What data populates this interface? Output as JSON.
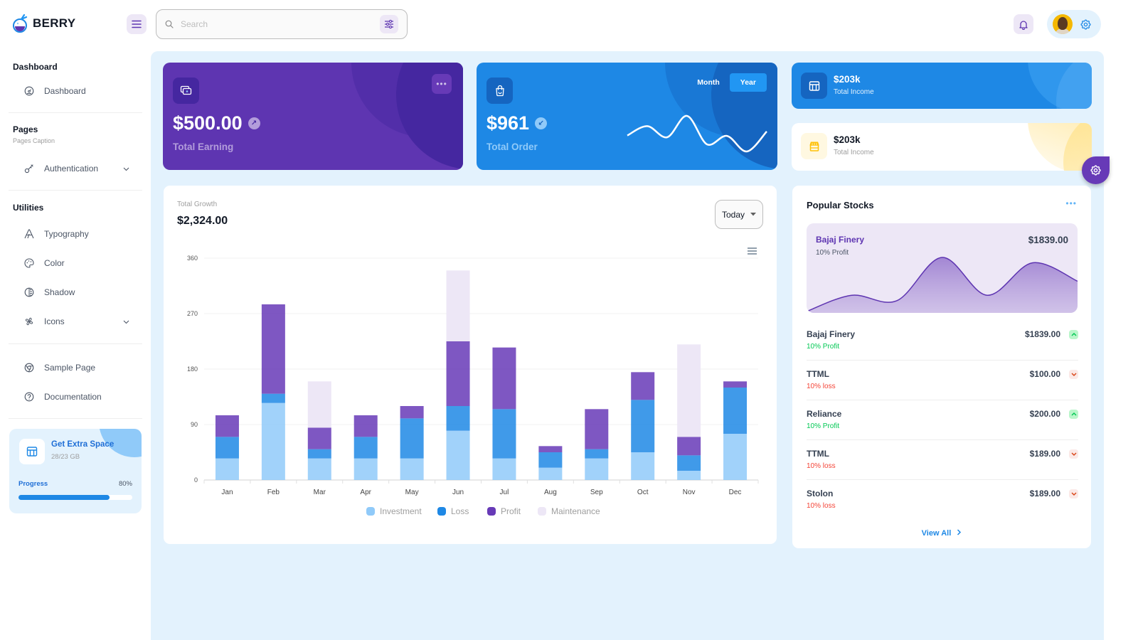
{
  "header": {
    "brand": "BERRY",
    "search_placeholder": "Search"
  },
  "sidebar": {
    "groups": [
      {
        "title": "Dashboard",
        "items": [
          {
            "label": "Dashboard",
            "icon": "dashboard-icon"
          }
        ]
      },
      {
        "title": "Pages",
        "caption": "Pages Caption",
        "items": [
          {
            "label": "Authentication",
            "icon": "key-icon",
            "expandable": true
          }
        ]
      },
      {
        "title": "Utilities",
        "items": [
          {
            "label": "Typography",
            "icon": "typography-icon"
          },
          {
            "label": "Color",
            "icon": "palette-icon"
          },
          {
            "label": "Shadow",
            "icon": "shadow-icon"
          },
          {
            "label": "Icons",
            "icon": "windmill-icon",
            "expandable": true
          }
        ]
      },
      {
        "items": [
          {
            "label": "Sample Page",
            "icon": "brand-chrome-icon"
          },
          {
            "label": "Documentation",
            "icon": "help-icon"
          }
        ]
      }
    ],
    "extra_space": {
      "title": "Get Extra Space",
      "subtitle": "28/23 GB",
      "progress_label": "Progress",
      "progress_text": "80%",
      "progress_value": 80
    }
  },
  "cards": {
    "earning": {
      "value": "$500.00",
      "label": "Total Earning",
      "trend": "up"
    },
    "order": {
      "value": "$961",
      "label": "Total Order",
      "trend": "down",
      "toggle": [
        "Month",
        "Year"
      ],
      "active_toggle": "Year",
      "sparkline": [
        45,
        66,
        41,
        89,
        25,
        44,
        9,
        54
      ]
    },
    "income_primary": {
      "value": "$203k",
      "label": "Total Income"
    },
    "income_secondary": {
      "value": "$203k",
      "label": "Total Income"
    }
  },
  "growth": {
    "subtitle": "Total Growth",
    "value": "$2,324.00",
    "period": "Today"
  },
  "chart_data": {
    "type": "bar",
    "stacked": true,
    "categories": [
      "Jan",
      "Feb",
      "Mar",
      "Apr",
      "May",
      "Jun",
      "Jul",
      "Aug",
      "Sep",
      "Oct",
      "Nov",
      "Dec"
    ],
    "series": [
      {
        "name": "Investment",
        "color": "#90caf9",
        "values": [
          35,
          125,
          35,
          35,
          35,
          80,
          35,
          20,
          35,
          45,
          15,
          75
        ]
      },
      {
        "name": "Loss",
        "color": "#1e88e5",
        "values": [
          35,
          15,
          15,
          35,
          65,
          40,
          80,
          25,
          15,
          85,
          25,
          75
        ]
      },
      {
        "name": "Profit",
        "color": "#673ab7",
        "values": [
          35,
          145,
          35,
          35,
          20,
          105,
          100,
          10,
          65,
          45,
          30,
          10
        ]
      },
      {
        "name": "Maintenance",
        "color": "#ede7f6",
        "values": [
          0,
          0,
          75,
          0,
          0,
          115,
          0,
          0,
          0,
          0,
          150,
          0
        ]
      }
    ],
    "yticks": [
      0,
      90,
      180,
      270,
      360
    ],
    "ylim": [
      0,
      360
    ],
    "grid": true,
    "legend": "bottom"
  },
  "stocks": {
    "title": "Popular Stocks",
    "hero": {
      "name": "Bajaj Finery",
      "sub": "10% Profit",
      "value": "$1839.00",
      "series": [
        0,
        15,
        10,
        50,
        15,
        45,
        28
      ]
    },
    "rows": [
      {
        "name": "Bajaj Finery",
        "price": "$1839.00",
        "change": "10% Profit",
        "trend": "up"
      },
      {
        "name": "TTML",
        "price": "$100.00",
        "change": "10% loss",
        "trend": "down"
      },
      {
        "name": "Reliance",
        "price": "$200.00",
        "change": "10% Profit",
        "trend": "up"
      },
      {
        "name": "TTML",
        "price": "$189.00",
        "change": "10% loss",
        "trend": "down"
      },
      {
        "name": "Stolon",
        "price": "$189.00",
        "change": "10% loss",
        "trend": "down"
      }
    ],
    "view_all": "View All"
  },
  "colors": {
    "primary": "#1e88e5",
    "secondary": "#5e35b1",
    "success": "#00c853",
    "error": "#f44336",
    "warning": "#ffc107"
  }
}
